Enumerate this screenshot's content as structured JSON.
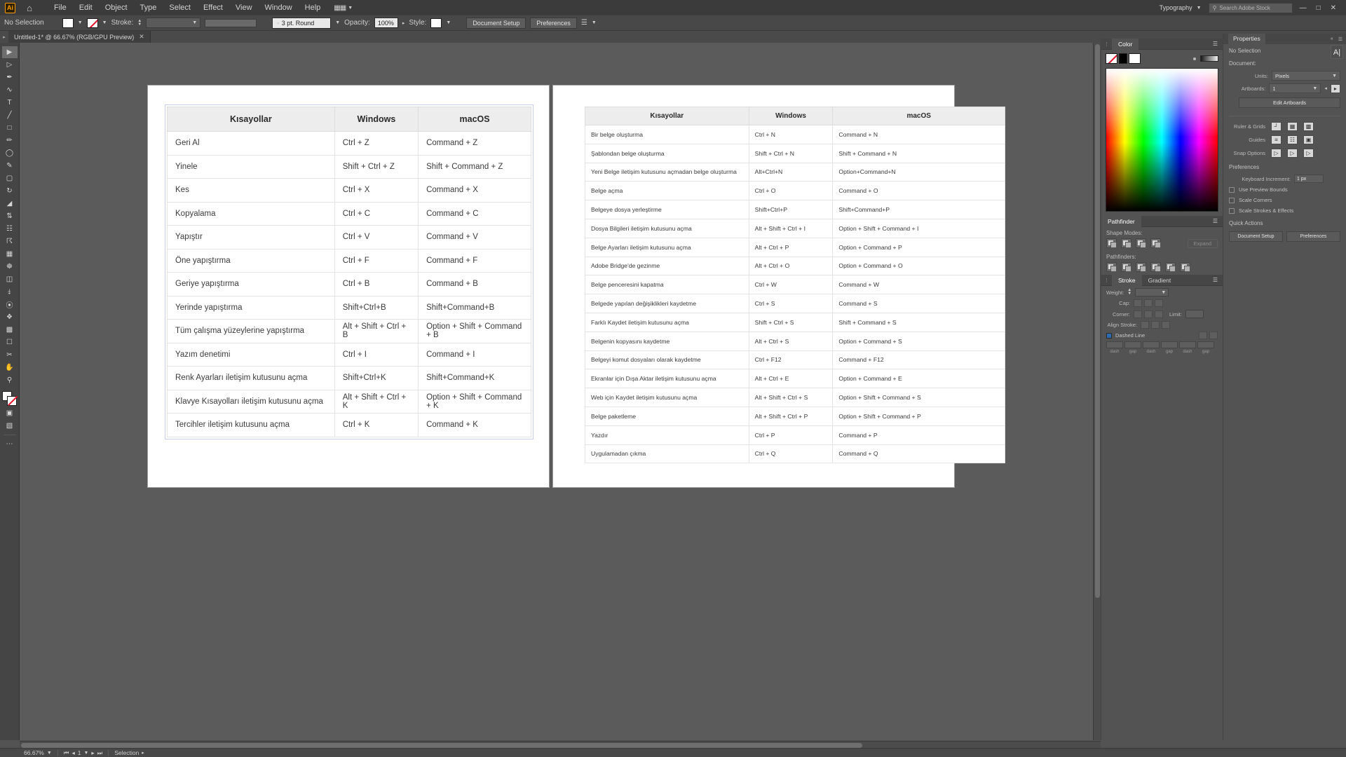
{
  "menubar": {
    "logo": "Ai",
    "home_icon": "home-icon",
    "items": [
      "File",
      "Edit",
      "Object",
      "Type",
      "Select",
      "Effect",
      "View",
      "Window",
      "Help"
    ],
    "grid_icon": "app-grid-icon",
    "typography_label": "Typography",
    "search_placeholder": "Search Adobe Stock",
    "window_buttons": [
      "minimize",
      "maximize",
      "close"
    ]
  },
  "controlbar": {
    "selection_status": "No Selection",
    "fill_swatch": "white",
    "stroke_swatch": "none",
    "stroke_label": "Stroke:",
    "stroke_weight": "",
    "brush_definition": "3 pt. Round",
    "opacity_label": "Opacity:",
    "opacity_value": "100%",
    "style_label": "Style:",
    "document_setup": "Document Setup",
    "preferences": "Preferences"
  },
  "tabbar": {
    "document_title": "Untitled-1* @ 66.67% (RGB/GPU Preview)",
    "close_icon": "close-icon"
  },
  "tools": [
    "selection-tool",
    "direct-selection-tool",
    "pen-tool",
    "curvature-tool",
    "type-tool",
    "line-segment-tool",
    "rectangle-tool",
    "paintbrush-tool",
    "shaper-tool",
    "pencil-tool",
    "eraser-tool",
    "rotate-tool",
    "scale-tool",
    "width-tool",
    "free-transform-tool",
    "shape-builder-tool",
    "perspective-grid-tool",
    "mesh-tool",
    "gradient-tool",
    "eyedropper-tool",
    "blend-tool",
    "symbol-sprayer-tool",
    "column-graph-tool",
    "artboard-tool",
    "slice-tool",
    "hand-tool",
    "zoom-tool",
    "more-tools"
  ],
  "statusbar": {
    "zoom": "66.67%",
    "artboard_nav": "1",
    "tool_status": "Selection"
  },
  "table_left": {
    "headers": [
      "Kısayollar",
      "Windows",
      "macOS"
    ],
    "rows": [
      [
        "Geri Al",
        "Ctrl + Z",
        "Command + Z"
      ],
      [
        "Yinele",
        "Shift + Ctrl + Z",
        "Shift + Command + Z"
      ],
      [
        "Kes",
        "Ctrl + X",
        "Command + X"
      ],
      [
        "Kopyalama",
        "Ctrl + C",
        "Command + C"
      ],
      [
        "Yapıştır",
        "Ctrl + V",
        "Command + V"
      ],
      [
        "Öne yapıştırma",
        "Ctrl + F",
        "Command + F"
      ],
      [
        "Geriye yapıştırma",
        "Ctrl + B",
        "Command + B"
      ],
      [
        "Yerinde yapıştırma",
        "Shift+Ctrl+B",
        "Shift+Command+B"
      ],
      [
        "Tüm çalışma yüzeylerine yapıştırma",
        "Alt + Shift + Ctrl + B",
        "Option + Shift + Command + B"
      ],
      [
        "Yazım denetimi",
        "Ctrl + I",
        "Command + I"
      ],
      [
        "Renk Ayarları iletişim kutusunu açma",
        "Shift+Ctrl+K",
        "Shift+Command+K"
      ],
      [
        "Klavye Kısayolları iletişim kutusunu açma",
        "Alt + Shift + Ctrl + K",
        "Option + Shift + Command + K"
      ],
      [
        "Tercihler iletişim kutusunu açma",
        "Ctrl + K",
        "Command + K"
      ]
    ]
  },
  "table_right": {
    "headers": [
      "Kısayollar",
      "Windows",
      "macOS"
    ],
    "rows": [
      [
        "Bir belge oluşturma",
        "Ctrl + N",
        "Command + N"
      ],
      [
        "Şablondan belge oluşturma",
        "Shift + Ctrl + N",
        "Shift + Command + N"
      ],
      [
        "Yeni Belge iletişim kutusunu açmadan belge oluşturma",
        "Alt+Ctrl+N",
        "Option+Command+N"
      ],
      [
        "Belge açma",
        "Ctrl + O",
        "Command + O"
      ],
      [
        "Belgeye dosya yerleştirme",
        "Shift+Ctrl+P",
        "Shift+Command+P"
      ],
      [
        "Dosya Bilgileri iletişim kutusunu açma",
        "Alt + Shift + Ctrl + I",
        "Option + Shift + Command + I"
      ],
      [
        "Belge Ayarları iletişim kutusunu açma",
        "Alt + Ctrl + P",
        "Option + Command + P"
      ],
      [
        "Adobe Bridge'de gezinme",
        "Alt + Ctrl + O",
        "Option + Command + O"
      ],
      [
        "Belge penceresini kapatma",
        "Ctrl + W",
        "Command + W"
      ],
      [
        "Belgede yapılan değişiklikleri kaydetme",
        "Ctrl + S",
        "Command  + S"
      ],
      [
        "Farklı Kaydet iletişim kutusunu açma",
        "Shift + Ctrl + S",
        "Shift + Command + S"
      ],
      [
        "Belgenin kopyasını kaydetme",
        "Alt + Ctrl + S",
        "Option + Command + S"
      ],
      [
        "Belgeyi komut dosyaları olarak kaydetme",
        "Ctrl + F12",
        "Command + F12"
      ],
      [
        "Ekranlar için Dışa Aktar iletişim kutusunu açma",
        "Alt + Ctrl + E",
        "Option + Command + E"
      ],
      [
        "Web için Kaydet iletişim kutusunu açma",
        "Alt + Shift + Ctrl + S",
        "Option + Shift + Command + S"
      ],
      [
        "Belge paketleme",
        "Alt + Shift + Ctrl + P",
        "Option + Shift + Command + P"
      ],
      [
        "Yazdır",
        "Ctrl + P",
        "Command + P"
      ],
      [
        "Uygulamadan çıkma",
        "Ctrl + Q",
        "Command + Q"
      ]
    ]
  },
  "color_panel": {
    "title": "Color",
    "menu_icon": "panel-menu-icon",
    "swatches": [
      "none",
      "black",
      "white"
    ]
  },
  "pathfinder_panel": {
    "title": "Pathfinder",
    "shape_modes_label": "Shape Modes:",
    "expand_label": "Expand",
    "pathfinders_label": "Pathfinders:"
  },
  "stroke_panel": {
    "title": "Stroke",
    "gradient_tab": "Gradient",
    "weight_label": "Weight:",
    "cap_label": "Cap:",
    "corner_label": "Corner:",
    "limit_label": "Limit:",
    "align_label": "Align Stroke:",
    "dashed_label": "Dashed Line",
    "dash_labels": [
      "dash",
      "gap",
      "dash",
      "gap",
      "dash",
      "gap"
    ]
  },
  "properties": {
    "title": "Properties",
    "selection_status": "No Selection",
    "document_label": "Document:",
    "units_label": "Units:",
    "units_value": "Pixels",
    "artboards_label": "Artboards:",
    "artboards_value": "1",
    "edit_artboards": "Edit Artboards",
    "ruler_grids_label": "Ruler & Grids",
    "guides_label": "Guides",
    "snap_options_label": "Snap Options",
    "preferences_label": "Preferences",
    "keyboard_increment_label": "Keyboard Increment:",
    "keyboard_increment_value": "1 px",
    "checkboxes": [
      "Use Preview Bounds",
      "Scale Corners",
      "Scale Strokes & Effects"
    ],
    "quick_actions_label": "Quick Actions",
    "document_setup": "Document Setup",
    "preferences_button": "Preferences"
  }
}
